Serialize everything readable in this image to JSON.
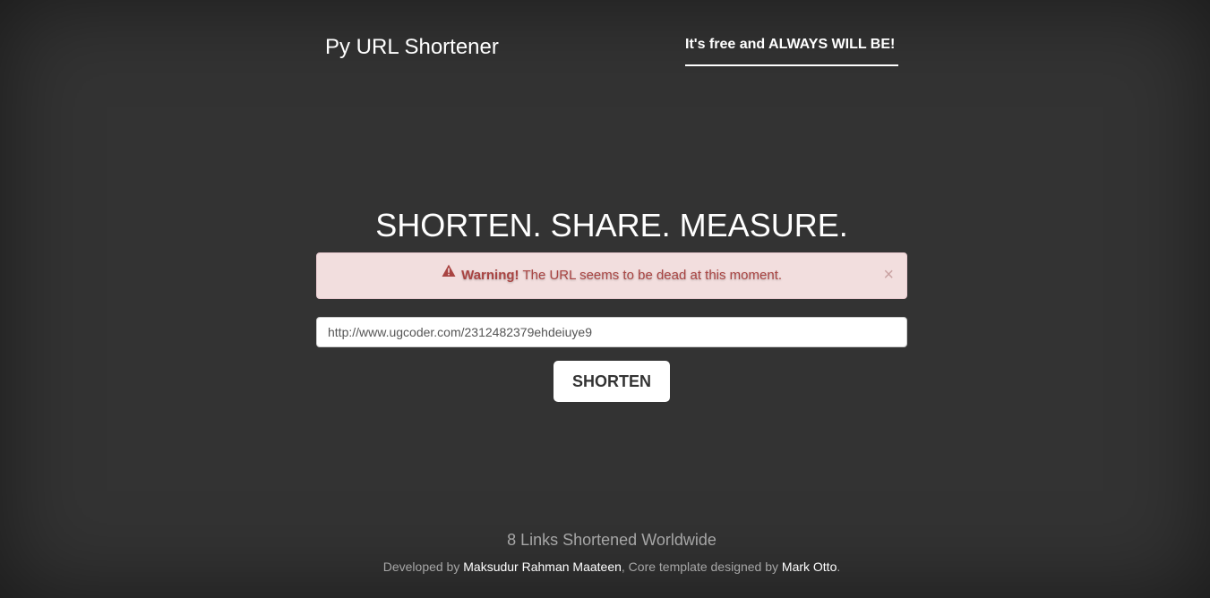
{
  "header": {
    "brand": "Py URL Shortener",
    "nav_link": "It's free and ALWAYS WILL BE!"
  },
  "main": {
    "headline": "SHORTEN. SHARE. MEASURE.",
    "alert": {
      "icon": "warning-triangle-icon",
      "strong": "Warning!",
      "message": "The URL seems to be dead at this moment.",
      "close": "×"
    },
    "url_input": {
      "value": "http://www.ugcoder.com/2312482379ehdeiuye9"
    },
    "button_label": "SHORTEN"
  },
  "footer": {
    "stats": "8 Links Shortened Worldwide",
    "credits": {
      "prefix": "Developed by ",
      "author": "Maksudur Rahman Maateen",
      "middle": ", Core template designed by ",
      "designer": "Mark Otto",
      "suffix": "."
    }
  },
  "colors": {
    "background": "#333333",
    "alert_bg": "#f2dede",
    "alert_text": "#a94442",
    "muted_text": "#a6a6a6"
  }
}
